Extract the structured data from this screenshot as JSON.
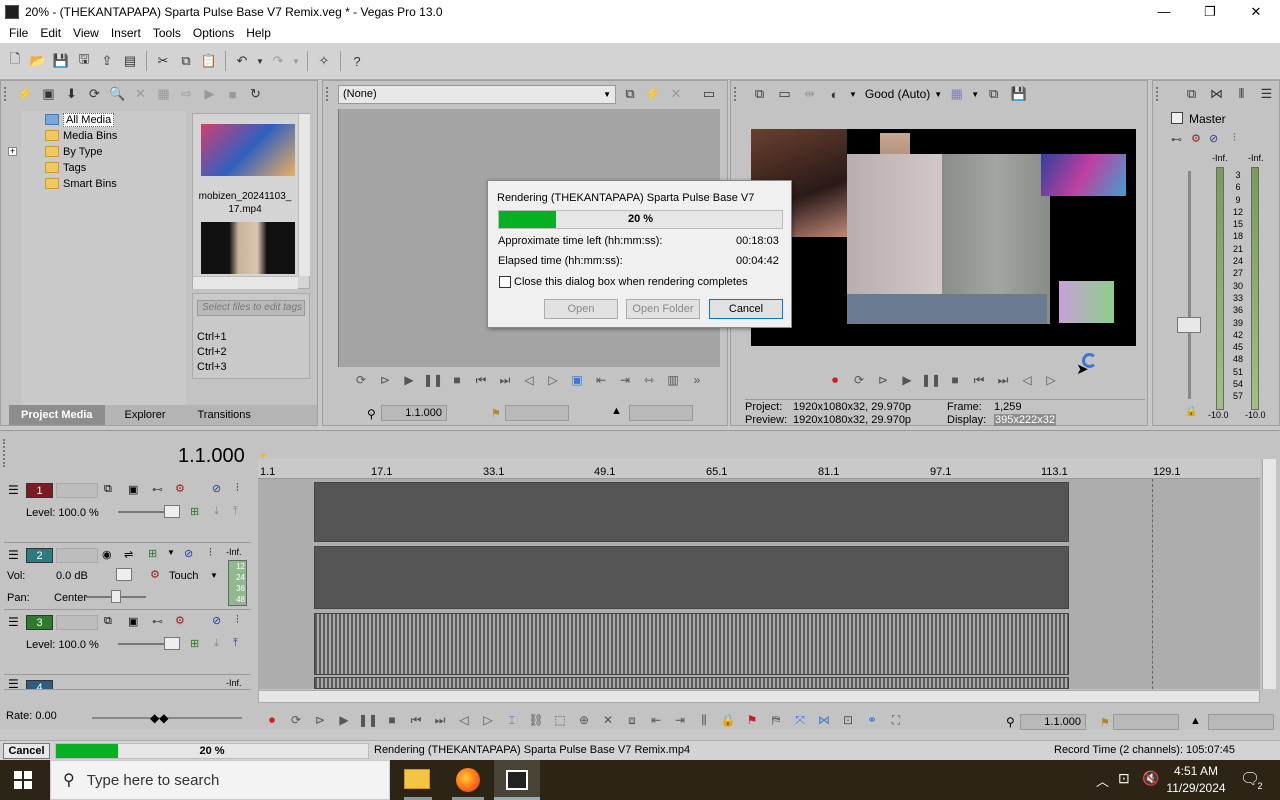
{
  "window": {
    "title": "20% - (THEKANTAPAPA) Sparta Pulse Base V7 Remix.veg * - Vegas Pro 13.0",
    "minimize": "—",
    "maximize": "❐",
    "close": "✕"
  },
  "menu": [
    "File",
    "Edit",
    "View",
    "Insert",
    "Tools",
    "Options",
    "Help"
  ],
  "media_tree": {
    "items": [
      "All Media",
      "Media Bins",
      "By Type",
      "Tags",
      "Smart Bins"
    ]
  },
  "media_files": {
    "file1": "mobizen_20241103_ 17.mp4",
    "search_placeholder": "Select files to edit tags",
    "shortcuts": [
      "Ctrl+1",
      "Ctrl+2",
      "Ctrl+3"
    ]
  },
  "bottom_tabs": [
    "Project Media",
    "Explorer",
    "Transitions"
  ],
  "trimmer": {
    "dropdown": "(None)",
    "timecode": "1.1.000"
  },
  "preview": {
    "quality": "Good (Auto)",
    "project_label": "Project:",
    "project_value": "1920x1080x32, 29.970p",
    "preview_label": "Preview:",
    "preview_value": "1920x1080x32, 29.970p",
    "frame_label": "Frame:",
    "frame_value": "1,259",
    "display_label": "Display:",
    "display_value": "395x222x32"
  },
  "master": {
    "title": "Master",
    "left_inf": "-Inf.",
    "right_inf": "-Inf.",
    "scale": [
      "3",
      "6",
      "9",
      "12",
      "15",
      "18",
      "21",
      "24",
      "27",
      "30",
      "33",
      "36",
      "39",
      "42",
      "45",
      "48",
      "51",
      "54",
      "57"
    ],
    "bottom_left": "-10.0",
    "bottom_right": "-10.0"
  },
  "dialog": {
    "title": "Rendering (THEKANTAPAPA) Sparta Pulse Base V7",
    "progress": 20,
    "progress_text": "20 %",
    "time_left_label": "Approximate time left (hh:mm:ss):",
    "time_left": "00:18:03",
    "elapsed_label": "Elapsed time (hh:mm:ss):",
    "elapsed": "00:04:42",
    "checkbox_label": "Close this dialog box when rendering completes",
    "open": "Open",
    "open_folder": "Open Folder",
    "cancel": "Cancel"
  },
  "timeline": {
    "cursor": "1.1.000",
    "ruler": [
      "1.1",
      "17.1",
      "33.1",
      "49.1",
      "65.1",
      "81.1",
      "97.1",
      "113.1",
      "129.1"
    ],
    "timecode": "1.1.000"
  },
  "tracks": [
    {
      "num": "1",
      "color": "#7a1c24",
      "level": "Level: 100.0 %"
    },
    {
      "num": "2",
      "color": "#2f7a80",
      "vol_label": "Vol:",
      "vol": "0.0 dB",
      "mode": "Touch",
      "pan_label": "Pan:",
      "pan": "Center",
      "inf": "-Inf.",
      "meter": [
        "12",
        "24",
        "36",
        "48"
      ]
    },
    {
      "num": "3",
      "color": "#2e7a2e",
      "level": "Level: 100.0 %"
    },
    {
      "num": "4",
      "color": "#2f5c80",
      "inf": "-Inf."
    }
  ],
  "rate": "Rate: 0.00",
  "status": {
    "cancel": "Cancel",
    "progress": 20,
    "progress_text": "20 %",
    "message": "Rendering (THEKANTAPAPA) Sparta Pulse Base V7 Remix.mp4",
    "record_time": "Record Time (2 channels): 105:07:45"
  },
  "taskbar": {
    "search_placeholder": "Type here to search",
    "time": "4:51 AM",
    "date": "11/29/2024",
    "notifications": "2"
  },
  "colors": {
    "progress": "#06b025",
    "accent": "#3a78d8"
  }
}
